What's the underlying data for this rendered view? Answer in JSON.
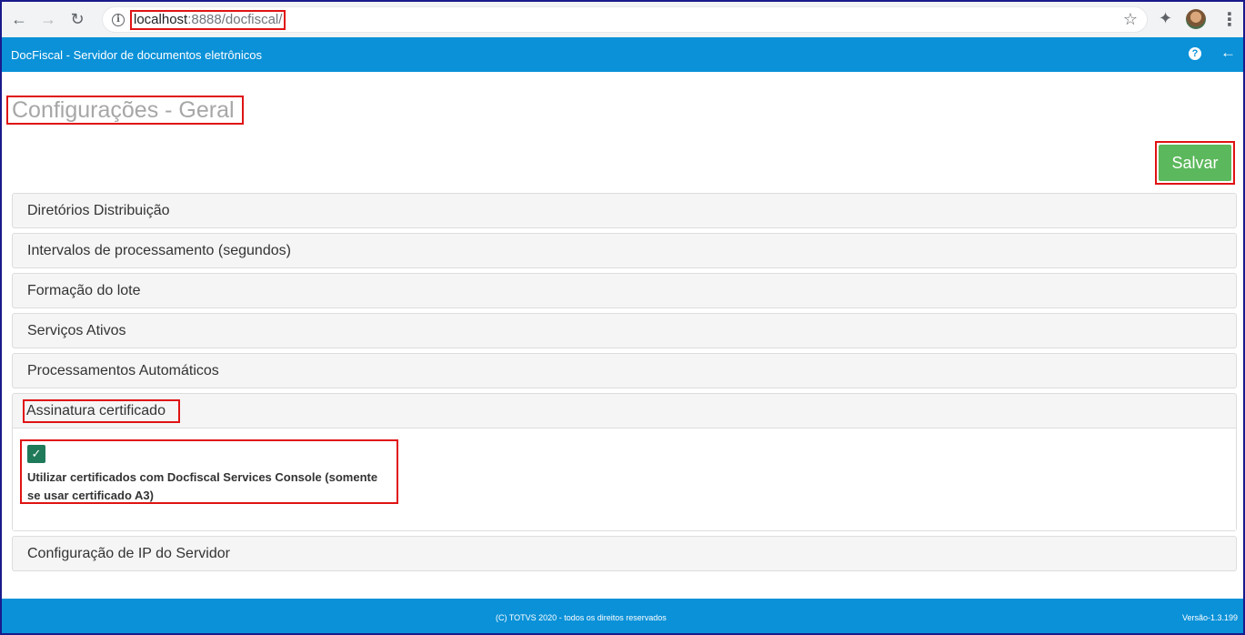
{
  "browser": {
    "url_host": "localhost",
    "url_rest": ":8888/docfiscal/",
    "back_icon": "arrow-left-icon",
    "forward_icon": "arrow-right-icon",
    "reload_icon": "reload-icon"
  },
  "header": {
    "title": "DocFiscal - Servidor de documentos eletrônicos"
  },
  "page": {
    "title": "Configurações - Geral",
    "save_label": "Salvar"
  },
  "sections": [
    {
      "label": "Diretórios Distribuição"
    },
    {
      "label": "Intervalos de processamento (segundos)"
    },
    {
      "label": "Formação do lote"
    },
    {
      "label": "Serviços Ativos"
    },
    {
      "label": "Processamentos Automáticos"
    },
    {
      "label": "Assinatura certificado",
      "expanded": true
    },
    {
      "label": "Configuração de IP do Servidor"
    }
  ],
  "certificate": {
    "checked": true,
    "label": "Utilizar certificados com Docfiscal Services Console (somente se usar certificado A3)"
  },
  "footer": {
    "copyright": "(C) TOTVS 2020 - todos os direitos reservados",
    "version": "Versão-1.3.199"
  },
  "colors": {
    "header": "#0a91d8",
    "save": "#5cb85c",
    "highlight": "#e01313"
  }
}
